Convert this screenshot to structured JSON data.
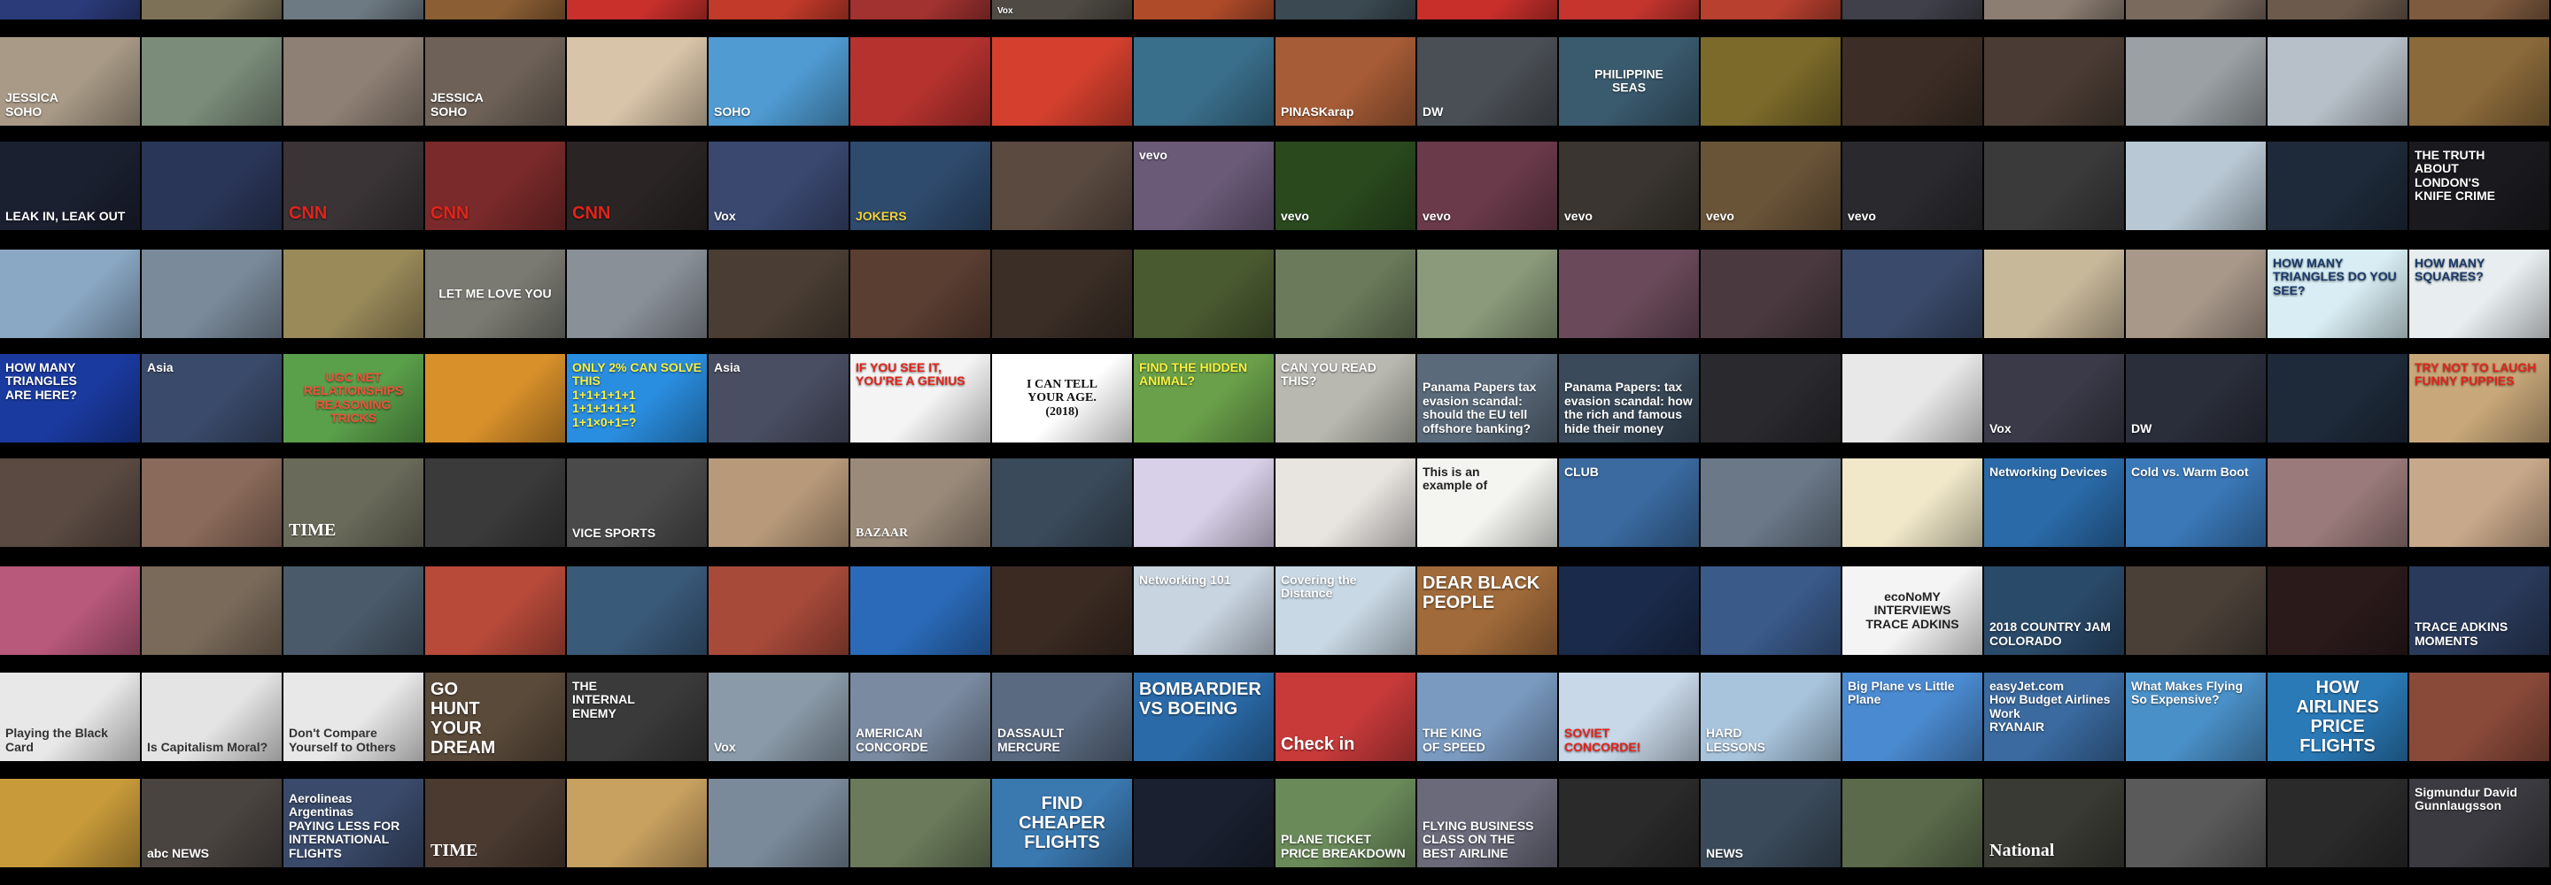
{
  "rows": [
    [
      {
        "caption": "",
        "bg": "#2b3b7a",
        "fg": "#ffffff"
      },
      {
        "caption": "",
        "bg": "#7d7258",
        "fg": "#ffffff"
      },
      {
        "caption": "",
        "bg": "#6e7a83",
        "fg": "#ffffff"
      },
      {
        "caption": "",
        "bg": "#8b5e34",
        "fg": "#ffffff"
      },
      {
        "caption": "",
        "bg": "#c9302c",
        "fg": "#ffffff"
      },
      {
        "caption": "",
        "bg": "#c23a2a",
        "fg": "#ffffff"
      },
      {
        "caption": "",
        "bg": "#a13230",
        "fg": "#ffffff"
      },
      {
        "caption": "Vox",
        "pos": "top",
        "bg": "#4f4a44",
        "fg": "#ffffff"
      },
      {
        "caption": "",
        "bg": "#b04b2a",
        "fg": "#ffffff"
      },
      {
        "caption": "",
        "bg": "#3b4a52",
        "fg": "#ffffff"
      },
      {
        "caption": "",
        "bg": "#c82f2b",
        "fg": "#ffffff"
      },
      {
        "caption": "",
        "bg": "#c5352e",
        "fg": "#ffffff"
      },
      {
        "caption": "",
        "bg": "#b8402f",
        "fg": "#ffffff"
      },
      {
        "caption": "",
        "bg": "#40404a",
        "fg": "#ffffff"
      },
      {
        "caption": "",
        "bg": "#8c7e72",
        "fg": "#ffffff"
      },
      {
        "caption": "",
        "bg": "#7a6a5e",
        "fg": "#ffffff"
      },
      {
        "caption": "",
        "bg": "#6c5a4c",
        "fg": "#ffffff"
      },
      {
        "caption": "",
        "bg": "#7e5a3e",
        "fg": "#ffffff"
      }
    ],
    [
      {
        "caption": "JESSICA\nSOHO",
        "bg": "#a89a86",
        "fg": "#ffffff"
      },
      {
        "caption": "",
        "bg": "#7b8c7a",
        "fg": "#ffffff"
      },
      {
        "caption": "",
        "bg": "#8e8074",
        "fg": "#ffffff"
      },
      {
        "caption": "JESSICA\nSOHO",
        "bg": "#6e6258",
        "fg": "#ffffff"
      },
      {
        "caption": "",
        "bg": "#d8c4a8",
        "fg": "#ffffff"
      },
      {
        "caption": "SOHO",
        "bg": "#4f9bd2",
        "fg": "#ffffff"
      },
      {
        "caption": "",
        "bg": "#b5322e",
        "fg": "#ffffff"
      },
      {
        "caption": "",
        "bg": "#d5402e",
        "fg": "#ffffff"
      },
      {
        "caption": "",
        "bg": "#3a6f8c",
        "fg": "#ffffff"
      },
      {
        "caption": "PINASKarap",
        "bg": "#a65c36",
        "fg": "#ffffff"
      },
      {
        "caption": "DW",
        "bg": "#4a4f55",
        "fg": "#ffffff"
      },
      {
        "caption": "PHILIPPINE\nSEAS",
        "pos": "mid",
        "bg": "#3a5a6e",
        "fg": "#ffffff"
      },
      {
        "caption": "",
        "bg": "#7b6a2a",
        "fg": "#ffffff"
      },
      {
        "caption": "",
        "bg": "#3c2e26",
        "fg": "#ffffff"
      },
      {
        "caption": "",
        "bg": "#4a3c34",
        "fg": "#ffffff"
      },
      {
        "caption": "",
        "bg": "#9aa0a4",
        "fg": "#ffffff"
      },
      {
        "caption": "",
        "bg": "#b7c0c8",
        "fg": "#ffffff"
      },
      {
        "caption": "",
        "bg": "#8a6a3a",
        "fg": "#ffffff"
      }
    ],
    [
      {
        "caption": "LEAK IN, LEAK OUT",
        "bg": "#1b2030",
        "fg": "#ffffff"
      },
      {
        "caption": "",
        "bg": "#2a3658",
        "fg": "#ffffff"
      },
      {
        "caption": "CNN",
        "size": "big",
        "bg": "#3a3436",
        "fg": "#e2231a"
      },
      {
        "caption": "CNN",
        "size": "big",
        "bg": "#7a2a2a",
        "fg": "#e2231a"
      },
      {
        "caption": "CNN",
        "size": "big",
        "bg": "#2a2424",
        "fg": "#e2231a"
      },
      {
        "caption": "Vox",
        "bg": "#3a4870",
        "fg": "#ffffff"
      },
      {
        "caption": "JOKERS",
        "bg": "#2e4a6c",
        "fg": "#f2d23a"
      },
      {
        "caption": "",
        "bg": "#5a4a40",
        "fg": "#ffffff"
      },
      {
        "caption": "vevo",
        "pos": "top",
        "bg": "#6a5a78",
        "fg": "#ffffff"
      },
      {
        "caption": "vevo",
        "bg": "#2a4a1e",
        "fg": "#ffffff"
      },
      {
        "caption": "vevo",
        "bg": "#6a3a4a",
        "fg": "#ffffff"
      },
      {
        "caption": "vevo",
        "bg": "#3a3530",
        "fg": "#ffffff"
      },
      {
        "caption": "vevo",
        "bg": "#6a5438",
        "fg": "#ffffff"
      },
      {
        "caption": "vevo",
        "bg": "#2a2a2e",
        "fg": "#ffffff"
      },
      {
        "caption": "",
        "bg": "#3a3a3a",
        "fg": "#ffffff"
      },
      {
        "caption": "",
        "bg": "#b8c8d4",
        "fg": "#ffffff"
      },
      {
        "caption": "",
        "bg": "#1e2a3a",
        "fg": "#ffffff"
      },
      {
        "caption": "THE TRUTH\nABOUT\nLONDON'S\nKNIFE CRIME",
        "pos": "top",
        "bg": "#1a1a1e",
        "fg": "#ffffff"
      }
    ],
    [
      {
        "caption": "",
        "bg": "#8aa8c4",
        "fg": "#ffffff"
      },
      {
        "caption": "",
        "bg": "#7a8a9a",
        "fg": "#ffffff"
      },
      {
        "caption": "",
        "bg": "#9a8a5a",
        "fg": "#ffffff"
      },
      {
        "caption": "LET ME LOVE YOU",
        "pos": "mid",
        "bg": "#7a7a72",
        "fg": "#ffffff"
      },
      {
        "caption": "",
        "bg": "#8a9098",
        "fg": "#ffffff"
      },
      {
        "caption": "",
        "bg": "#4a3e34",
        "fg": "#ffffff"
      },
      {
        "caption": "",
        "bg": "#5a3e32",
        "fg": "#ffffff"
      },
      {
        "caption": "",
        "bg": "#3a2e26",
        "fg": "#ffffff"
      },
      {
        "caption": "",
        "bg": "#4a5a30",
        "fg": "#ffffff"
      },
      {
        "caption": "",
        "bg": "#6a7a5a",
        "fg": "#ffffff"
      },
      {
        "caption": "",
        "bg": "#8a9a7a",
        "fg": "#ffffff"
      },
      {
        "caption": "",
        "bg": "#6a4a5a",
        "fg": "#ffffff"
      },
      {
        "caption": "",
        "bg": "#4a3a40",
        "fg": "#ffffff"
      },
      {
        "caption": "",
        "bg": "#3a4a6a",
        "fg": "#ffffff"
      },
      {
        "caption": "",
        "bg": "#c8b89a",
        "fg": "#ffffff"
      },
      {
        "caption": "",
        "bg": "#a8988a",
        "fg": "#ffffff"
      },
      {
        "caption": "HOW MANY TRIANGLES DO YOU SEE?",
        "pos": "top",
        "bg": "#d8eef4",
        "fg": "#1a3a6a"
      },
      {
        "caption": "HOW MANY SQUARES?",
        "pos": "top",
        "bg": "#e8eef0",
        "fg": "#1a3a6a"
      }
    ],
    [
      {
        "caption": "HOW MANY\nTRIANGLES\nARE HERE?",
        "pos": "top",
        "bg": "#1a3aa0",
        "fg": "#ffffff"
      },
      {
        "caption": "Asia",
        "pos": "top",
        "bg": "#3a4a6a",
        "fg": "#ffffff"
      },
      {
        "caption": "UGC NET\nRELATIONSHIPS\nREASONING\nTRICKS",
        "pos": "mid",
        "bg": "#5aa04a",
        "fg": "#f2503a"
      },
      {
        "caption": "",
        "bg": "#d8902a",
        "fg": "#ffffff"
      },
      {
        "caption": "ONLY 2% CAN SOLVE THIS\n1+1+1+1+1\n1+1+1+1+1\n1+1×0+1=?",
        "pos": "top",
        "bg": "#2a8ee0",
        "fg": "#f8f040"
      },
      {
        "caption": "Asia",
        "pos": "top",
        "bg": "#4a4e62",
        "fg": "#ffffff"
      },
      {
        "caption": "IF YOU SEE IT, YOU'RE A GENIUS",
        "pos": "top",
        "bg": "#f4f4f4",
        "fg": "#e2231a"
      },
      {
        "caption": "I CAN TELL\nYOUR AGE.\n(2018)",
        "pos": "mid",
        "font": "serif",
        "bg": "#ffffff",
        "fg": "#111111"
      },
      {
        "caption": "FIND THE HIDDEN ANIMAL?",
        "pos": "top",
        "bg": "#6aa04a",
        "fg": "#f8f040"
      },
      {
        "caption": "CAN YOU READ THIS?",
        "pos": "top",
        "bg": "#b8b8b0",
        "fg": "#ffffff"
      },
      {
        "caption": "Panama Papers tax evasion scandal: should the EU tell offshore banking?",
        "bg": "#5a6a7a",
        "fg": "#ffffff"
      },
      {
        "caption": "Panama Papers: tax evasion scandal: how the rich and famous hide their money",
        "bg": "#3a4a5a",
        "fg": "#ffffff"
      },
      {
        "caption": "",
        "bg": "#2a2a2e",
        "fg": "#ffffff"
      },
      {
        "caption": "",
        "bg": "#e8e8e8",
        "fg": "#ffffff"
      },
      {
        "caption": "Vox",
        "bg": "#3a3a48",
        "fg": "#ffffff"
      },
      {
        "caption": "DW",
        "bg": "#2a2e3a",
        "fg": "#ffffff"
      },
      {
        "caption": "",
        "bg": "#1e2a3a",
        "fg": "#ffffff"
      },
      {
        "caption": "TRY NOT TO LAUGH\nFUNNY PUPPIES",
        "pos": "top",
        "bg": "#c8a87a",
        "fg": "#e2231a"
      }
    ],
    [
      {
        "caption": "",
        "bg": "#5a4a42",
        "fg": "#ffffff"
      },
      {
        "caption": "",
        "bg": "#8a6a5a",
        "fg": "#ffffff"
      },
      {
        "caption": "TIME",
        "size": "big",
        "font": "serif",
        "bg": "#6a6a5a",
        "fg": "#ffffff"
      },
      {
        "caption": "",
        "bg": "#3a3a3a",
        "fg": "#ffffff"
      },
      {
        "caption": "VICE SPORTS",
        "bg": "#4a4a4a",
        "fg": "#ffffff"
      },
      {
        "caption": "",
        "bg": "#b89a7a",
        "fg": "#ffffff"
      },
      {
        "caption": "BAZAAR",
        "font": "serif",
        "bg": "#9a8a7a",
        "fg": "#ffffff"
      },
      {
        "caption": "",
        "bg": "#3a4a5a",
        "fg": "#ffffff"
      },
      {
        "caption": "",
        "bg": "#d8d0e8",
        "fg": "#ffffff"
      },
      {
        "caption": "",
        "bg": "#e8e4e0",
        "fg": "#ffffff"
      },
      {
        "caption": "This is an\nexample of",
        "pos": "top",
        "bg": "#f4f4f0",
        "fg": "#222222"
      },
      {
        "caption": "CLUB",
        "pos": "top",
        "bg": "#3a6aa0",
        "fg": "#ffffff"
      },
      {
        "caption": "",
        "bg": "#6a7888",
        "fg": "#ffffff"
      },
      {
        "caption": "",
        "bg": "#f0e8c8",
        "fg": "#ffffff"
      },
      {
        "caption": "Networking Devices",
        "pos": "top",
        "bg": "#2a6aa8",
        "fg": "#ffffff"
      },
      {
        "caption": "Cold vs. Warm Boot",
        "pos": "top",
        "bg": "#3a78b8",
        "fg": "#ffffff"
      },
      {
        "caption": "",
        "bg": "#9a7a7a",
        "fg": "#ffffff"
      },
      {
        "caption": "",
        "bg": "#c8a88a",
        "fg": "#ffffff"
      }
    ],
    [
      {
        "caption": "",
        "bg": "#b8587a",
        "fg": "#ffffff"
      },
      {
        "caption": "",
        "bg": "#7a6a5a",
        "fg": "#ffffff"
      },
      {
        "caption": "",
        "bg": "#4a5a6a",
        "fg": "#ffffff"
      },
      {
        "caption": "",
        "bg": "#b84a3a",
        "fg": "#ffffff"
      },
      {
        "caption": "",
        "bg": "#3a5a7a",
        "fg": "#ffffff"
      },
      {
        "caption": "",
        "bg": "#a84a3a",
        "fg": "#ffffff"
      },
      {
        "caption": "",
        "bg": "#2a6ab8",
        "fg": "#ffffff"
      },
      {
        "caption": "",
        "bg": "#3a2a22",
        "fg": "#ffffff"
      },
      {
        "caption": "Networking 101",
        "pos": "top",
        "bg": "#c8d4e0",
        "fg": "#ffffff"
      },
      {
        "caption": "Covering the Distance",
        "pos": "top",
        "bg": "#c8d8e4",
        "fg": "#ffffff"
      },
      {
        "caption": "DEAR BLACK\nPEOPLE",
        "pos": "top",
        "size": "big",
        "bg": "#a06a3a",
        "fg": "#ffffff"
      },
      {
        "caption": "",
        "bg": "#1a2a4a",
        "fg": "#ffffff"
      },
      {
        "caption": "",
        "bg": "#3a5a8a",
        "fg": "#ffffff"
      },
      {
        "caption": "ecoNoMY\nINTERVIEWS\nTRACE ADKINS",
        "pos": "mid",
        "bg": "#f4f4f4",
        "fg": "#222222"
      },
      {
        "caption": "2018 COUNTRY JAM COLORADO",
        "bg": "#2a4a6a",
        "fg": "#ffffff"
      },
      {
        "caption": "",
        "bg": "#4a4038",
        "fg": "#ffffff"
      },
      {
        "caption": "",
        "bg": "#2a1a1a",
        "fg": "#ffffff"
      },
      {
        "caption": "TRACE ADKINS\nMOMENTS",
        "bg": "#2a3a5a",
        "fg": "#ffffff"
      }
    ],
    [
      {
        "caption": "Playing the Black Card",
        "bg": "#e8e8e8",
        "fg": "#333333"
      },
      {
        "caption": "Is Capitalism Moral?",
        "bg": "#e4e4e4",
        "fg": "#333333"
      },
      {
        "caption": "Don't Compare Yourself to Others",
        "bg": "#e8e8e8",
        "fg": "#333333"
      },
      {
        "caption": "GO\nHUNT\nYOUR\nDREAM",
        "pos": "top",
        "size": "big",
        "bg": "#5a4a3a",
        "fg": "#ffffff"
      },
      {
        "caption": "THE\nINTERNAL\nENEMY",
        "pos": "top",
        "bg": "#3a3a3a",
        "fg": "#ffffff"
      },
      {
        "caption": "Vox",
        "bg": "#8a9aa8",
        "fg": "#ffffff"
      },
      {
        "caption": "AMERICAN\nCONCORDE",
        "bg": "#7a8aa0",
        "fg": "#ffffff"
      },
      {
        "caption": "DASSAULT\nMERCURE",
        "bg": "#5a6a80",
        "fg": "#ffffff"
      },
      {
        "caption": "BOMBARDIER\nVS BOEING",
        "pos": "top",
        "size": "big",
        "bg": "#2a6aa8",
        "fg": "#ffffff"
      },
      {
        "caption": "Check in",
        "size": "big",
        "bg": "#c83a3a",
        "fg": "#ffffff"
      },
      {
        "caption": "THE KING\nOF SPEED",
        "bg": "#7a9ac0",
        "fg": "#ffffff"
      },
      {
        "caption": "SOVIET\nCONCORDE!",
        "bg": "#c8d8e8",
        "fg": "#e2231a"
      },
      {
        "caption": "HARD\nLESSONS",
        "bg": "#a8c4dc",
        "fg": "#ffffff"
      },
      {
        "caption": "Big Plane vs Little Plane",
        "pos": "top",
        "bg": "#4a8ad0",
        "fg": "#ffffff"
      },
      {
        "caption": "easyJet.com\nHow Budget Airlines Work\nRYANAIR",
        "pos": "top",
        "bg": "#3a6aa0",
        "fg": "#ffffff"
      },
      {
        "caption": "What Makes Flying\nSo Expensive?",
        "pos": "top",
        "bg": "#4a90c8",
        "fg": "#ffffff"
      },
      {
        "caption": "HOW\nAIRLINES\nPRICE FLIGHTS",
        "pos": "mid",
        "size": "big",
        "bg": "#2a7ab8",
        "fg": "#ffffff"
      },
      {
        "caption": "",
        "bg": "#8a4a3a",
        "fg": "#ffffff"
      }
    ],
    [
      {
        "caption": "",
        "bg": "#c89a3a",
        "fg": "#ffffff"
      },
      {
        "caption": "abc NEWS",
        "bg": "#4a4440",
        "fg": "#ffffff"
      },
      {
        "caption": "Aerolineas Argentinas\nPAYING LESS FOR\nINTERNATIONAL FLIGHTS",
        "bg": "#3a4a6a",
        "fg": "#ffffff"
      },
      {
        "caption": "TIME",
        "size": "big",
        "font": "serif",
        "bg": "#4a3a30",
        "fg": "#ffffff"
      },
      {
        "caption": "",
        "bg": "#c8a060",
        "fg": "#ffffff"
      },
      {
        "caption": "",
        "bg": "#7a8a9a",
        "fg": "#ffffff"
      },
      {
        "caption": "",
        "bg": "#6a7a5a",
        "fg": "#ffffff"
      },
      {
        "caption": "FIND\nCHEAPER\nFLIGHTS",
        "pos": "mid",
        "size": "big",
        "bg": "#3a78b0",
        "fg": "#ffffff"
      },
      {
        "caption": "",
        "bg": "#1a2030",
        "fg": "#ffffff"
      },
      {
        "caption": "PLANE TICKET\nPRICE BREAKDOWN",
        "bg": "#6a8a5a",
        "fg": "#ffffff"
      },
      {
        "caption": "FLYING BUSINESS\nCLASS ON THE\nBEST AIRLINE",
        "bg": "#6a6a7a",
        "fg": "#ffffff"
      },
      {
        "caption": "",
        "bg": "#2a2a2a",
        "fg": "#ffffff"
      },
      {
        "caption": "NEWS",
        "bg": "#3a4a5a",
        "fg": "#ffffff"
      },
      {
        "caption": "",
        "bg": "#5a6a4a",
        "fg": "#ffffff"
      },
      {
        "caption": "National",
        "size": "big",
        "font": "serif",
        "bg": "#3a3a34",
        "fg": "#ffffff"
      },
      {
        "caption": "",
        "bg": "#5a5a5a",
        "fg": "#ffffff"
      },
      {
        "caption": "",
        "bg": "#2a2a2a",
        "fg": "#ffffff"
      },
      {
        "caption": "Sigmundur David\nGunnlaugsson",
        "pos": "top",
        "bg": "#3a3a40",
        "fg": "#ffffff"
      }
    ]
  ]
}
